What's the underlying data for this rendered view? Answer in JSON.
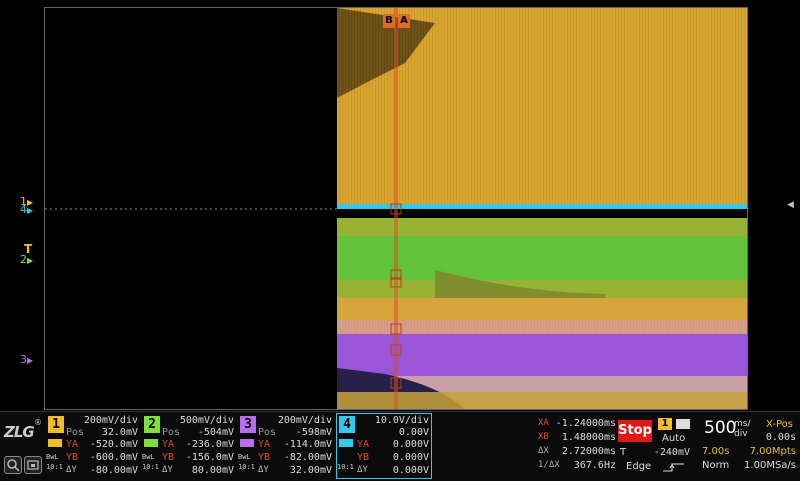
{
  "colors": {
    "ch1": "#f0be2a",
    "ch2": "#7ee03a",
    "ch3": "#b86cf0",
    "ch4": "#36c8e8",
    "cursor": "#d8501a",
    "stop": "#e01818"
  },
  "cursor_labels": {
    "b": "B",
    "a": "A"
  },
  "left_markers": {
    "ch1": "1",
    "ch4": "4",
    "ch2": "2",
    "ch3": "3",
    "trigger": "T"
  },
  "channels": [
    {
      "num": "1",
      "scale": "200mV/div",
      "pos_label": "Pos",
      "pos": "32.0mV",
      "ya_label": "YA",
      "ya": "-520.0mV",
      "yb_label": "YB",
      "yb": "-600.0mV",
      "dy_label": "ΔY",
      "dy": "-80.00mV",
      "bw": "BwL",
      "probe": "10:1"
    },
    {
      "num": "2",
      "scale": "500mV/div",
      "pos_label": "Pos",
      "pos": "-504mV",
      "ya_label": "YA",
      "ya": "-236.0mV",
      "yb_label": "YB",
      "yb": "-156.0mV",
      "dy_label": "ΔY",
      "dy": "80.00mV",
      "bw": "BwL",
      "probe": "10:1"
    },
    {
      "num": "3",
      "scale": "200mV/div",
      "pos_label": "Pos",
      "pos": "-598mV",
      "ya_label": "YA",
      "ya": "-114.0mV",
      "yb_label": "YB",
      "yb": "-82.00mV",
      "dy_label": "ΔY",
      "dy": "32.00mV",
      "bw": "BwL",
      "probe": "10:1"
    },
    {
      "num": "4",
      "scale": "10.0V/div",
      "pos_label": "",
      "pos": "0.00V",
      "ya_label": "YA",
      "ya": "0.000V",
      "yb_label": "YB",
      "yb": "0.000V",
      "dy_label": "ΔY",
      "dy": "0.000V",
      "bw": "",
      "probe": "10:1"
    }
  ],
  "cursor_readout": {
    "xa_label": "XA",
    "xa": "-1.24000ms",
    "xb_label": "XB",
    "xb": "1.48000ms",
    "dx_label": "ΔX",
    "dx": "2.72000ms",
    "inv_label": "1/ΔX",
    "inv": "367.6Hz"
  },
  "run": {
    "status": "Stop"
  },
  "trigger": {
    "source": "1",
    "mode": "Auto",
    "level_label": "T",
    "level": "-240mV",
    "type": "Edge"
  },
  "timebase": {
    "value": "500",
    "unit_top": "ms/",
    "unit_bottom": "div",
    "xpos_label": "X-Pos",
    "xpos": "0.00s",
    "window": "7.00s",
    "depth": "7.00Mpts",
    "acq": "Norm",
    "rate": "1.00MSa/s"
  },
  "logo": "ZLG"
}
